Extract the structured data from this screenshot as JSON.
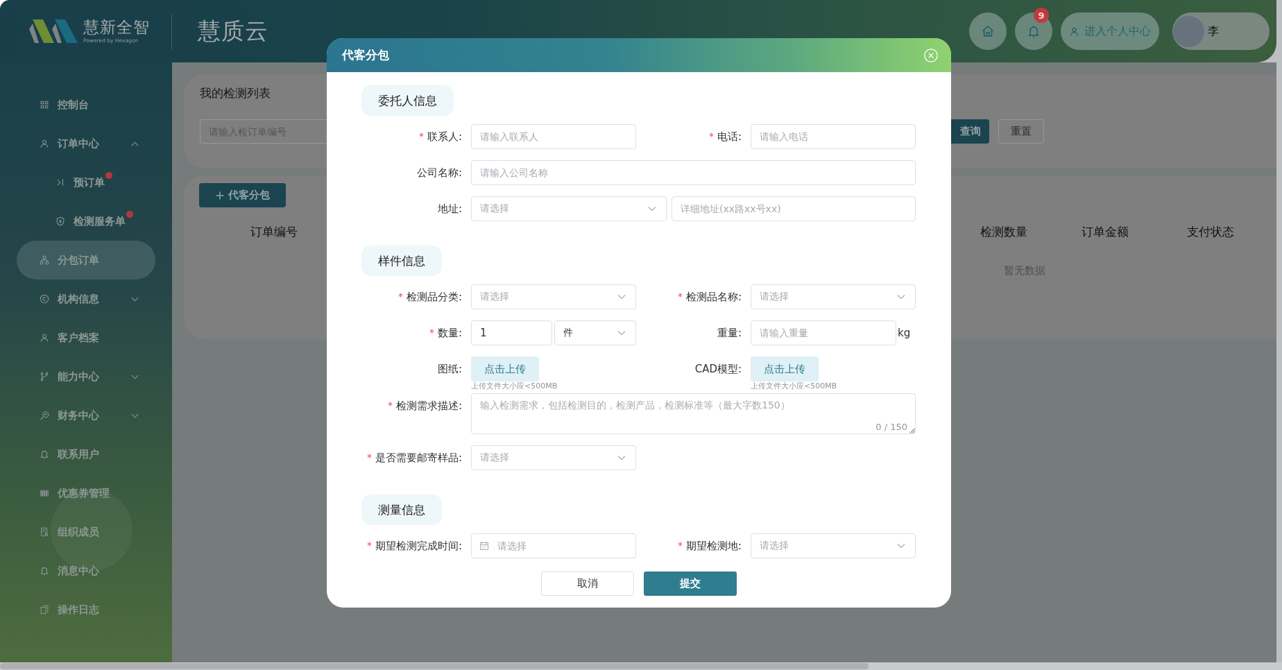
{
  "sidebar": {
    "logo_text": "慧新全智",
    "logo_tagline": "Powered by Hexagon",
    "items": [
      {
        "label": "控制台",
        "kind": "link",
        "selected": false,
        "dot": false
      },
      {
        "label": "订单中心",
        "kind": "group",
        "expanded": true,
        "selected": false,
        "dot": false,
        "children": [
          {
            "label": "预订单",
            "selected": false,
            "dot": true
          },
          {
            "label": "检测服务单",
            "selected": false,
            "dot": true
          }
        ]
      },
      {
        "label": "分包订单",
        "kind": "link",
        "selected": true,
        "dot": false
      },
      {
        "label": "机构信息",
        "kind": "group",
        "expanded": false,
        "selected": false,
        "dot": false
      },
      {
        "label": "客户档案",
        "kind": "link",
        "selected": false,
        "dot": false
      },
      {
        "label": "能力中心",
        "kind": "group",
        "expanded": false,
        "selected": false,
        "dot": false
      },
      {
        "label": "财务中心",
        "kind": "group",
        "expanded": false,
        "selected": false,
        "dot": false
      },
      {
        "label": "联系用户",
        "kind": "link",
        "selected": false,
        "dot": false
      },
      {
        "label": "优惠券管理",
        "kind": "link",
        "selected": false,
        "dot": false
      },
      {
        "label": "组织成员",
        "kind": "link",
        "selected": false,
        "dot": false
      },
      {
        "label": "消息中心",
        "kind": "link",
        "selected": false,
        "dot": false
      },
      {
        "label": "操作日志",
        "kind": "link",
        "selected": false,
        "dot": false
      }
    ]
  },
  "header": {
    "app_title": "慧质云",
    "notification_count": "9",
    "profile_link": "进入个人中心",
    "user_name": "李"
  },
  "search_card": {
    "title": "我的检测列表",
    "search_placeholder": "请输入检订单编号",
    "buttons": [
      {
        "label": "查询",
        "kind": "primary"
      },
      {
        "label": "重置",
        "kind": "plain"
      }
    ]
  },
  "table_card": {
    "add_button": "代客分包",
    "columns": [
      "订单编号",
      "检测数量",
      "订单金额",
      "支付状态"
    ],
    "empty_text": "暂无数据"
  },
  "dialog": {
    "title": "代客分包",
    "sections": [
      {
        "title": "委托人信息",
        "rows": [
          [
            {
              "kind": "text",
              "label": "联系人:",
              "required": true,
              "placeholder": "请输入联系人"
            },
            {
              "kind": "text",
              "label": "电话:",
              "required": true,
              "placeholder": "请输入电话"
            }
          ],
          [
            {
              "kind": "text",
              "label": "公司名称:",
              "required": false,
              "placeholder": "请输入公司名称"
            }
          ],
          [
            {
              "kind": "address",
              "label": "地址:",
              "required": false,
              "select_placeholder": "请选择",
              "detail_placeholder": "详细地址(xx路xx号xx)"
            }
          ]
        ]
      },
      {
        "title": "样件信息",
        "rows": [
          [
            {
              "kind": "select",
              "label": "检测品分类:",
              "required": true,
              "placeholder": "请选择"
            },
            {
              "kind": "select",
              "label": "检测品名称:",
              "required": true,
              "placeholder": "请选择"
            }
          ],
          [
            {
              "kind": "quantity",
              "label": "数量:",
              "required": true,
              "value": "1",
              "unit": "件"
            },
            {
              "kind": "measure",
              "label": "重量:",
              "required": false,
              "placeholder": "请输入重量",
              "unit": "kg"
            }
          ],
          [
            {
              "kind": "upload",
              "label": "图纸:",
              "required": false,
              "button": "点击上传",
              "hint": "上传文件大小应<500MB"
            },
            {
              "kind": "upload",
              "label": "CAD模型:",
              "required": false,
              "button": "点击上传",
              "hint": "上传文件大小应<500MB"
            }
          ],
          [
            {
              "kind": "textarea",
              "label": "检测需求描述:",
              "required": true,
              "placeholder": "输入检测需求，包括检测目的，检测产品，检测标准等（最大字数150）",
              "counter": "0 / 150"
            }
          ],
          [
            {
              "kind": "select",
              "label": "是否需要邮寄样品:",
              "required": true,
              "placeholder": "请选择"
            }
          ]
        ]
      },
      {
        "title": "测量信息",
        "rows": [
          [
            {
              "kind": "date",
              "label": "期望检测完成时间:",
              "required": true,
              "placeholder": "请选择"
            },
            {
              "kind": "select",
              "label": "期望检测地:",
              "required": true,
              "placeholder": "请选择"
            }
          ]
        ]
      }
    ],
    "buttons": [
      {
        "label": "取消",
        "kind": "plain"
      },
      {
        "label": "提交",
        "kind": "primary"
      }
    ]
  }
}
